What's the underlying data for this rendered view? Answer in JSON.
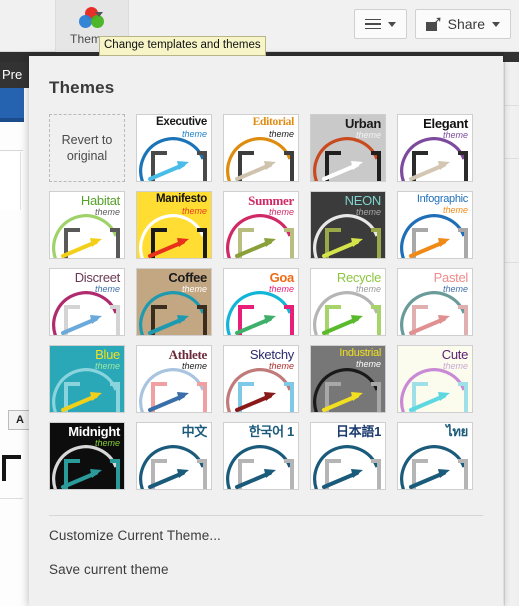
{
  "toolbar": {
    "themes_button_label": "Themes",
    "themes_icon": "color-circles-icon",
    "themes_dropdown_icon": "chevron-down-icon",
    "tooltip_text": "Change templates and themes",
    "menu_icon": "hamburger-icon",
    "menu_dropdown_icon": "chevron-down-icon",
    "share_label": "Share",
    "share_icon": "share-arrow-icon",
    "share_dropdown_icon": "chevron-down-icon"
  },
  "background": {
    "presentation_tab_label": "Pre",
    "align_button_label": "A"
  },
  "panel": {
    "title": "Themes",
    "revert_label": "Revert to original",
    "menu": [
      {
        "label": "Customize Current Theme..."
      },
      {
        "label": "Save current theme"
      }
    ],
    "themes": [
      {
        "name": "Executive",
        "sub": "theme",
        "bg": "#ffffff",
        "title_color": "#1a1a1a",
        "sub_color": "#1d7fc4",
        "arc_color": "#1b74b8",
        "arrow_color": "#49bde8",
        "bracket_color": "#4a4a4a",
        "title_style": "bold"
      },
      {
        "name": "Editorial",
        "sub": "theme",
        "bg": "#ffffff",
        "title_color": "#e08b12",
        "sub_color": "#1a1a1a",
        "arc_color": "#de8c10",
        "arrow_color": "#cfc3ae",
        "bracket_color": "#3d3d3d",
        "title_style": "serif"
      },
      {
        "name": "Urban",
        "sub": "theme",
        "bg": "#c9c9c9",
        "title_color": "#1a1a1a",
        "sub_color": "#f2f2f2",
        "arc_color": "#c94a1e",
        "arrow_color": "#ffffff",
        "bracket_color": "#1f1f1f",
        "title_style": "bold"
      },
      {
        "name": "Elegant",
        "sub": "theme",
        "bg": "#ffffff",
        "title_color": "#111111",
        "sub_color": "#7d4a9e",
        "arc_color": "#7d4a9e",
        "arrow_color": "#d3c6b2",
        "bracket_color": "#2b2b2b",
        "title_style": "bold"
      },
      {
        "name": "Habitat",
        "sub": "theme",
        "bg": "#ffffff",
        "title_color": "#57a22b",
        "sub_color": "#5a5a5a",
        "arc_color": "#9fd36a",
        "arrow_color": "#f2d01a",
        "bracket_color": "#595959",
        "title_style": "normal"
      },
      {
        "name": "Manifesto",
        "sub": "theme",
        "bg": "#ffdd33",
        "title_color": "#111111",
        "sub_color": "#e23d1e",
        "arc_color": "#ffffff",
        "arrow_color": "#e8301a",
        "bracket_color": "#1a1a1a",
        "title_style": "bold"
      },
      {
        "name": "Summer",
        "sub": "theme",
        "bg": "#ffffff",
        "title_color": "#cf2a66",
        "sub_color": "#cf2a66",
        "arc_color": "#cf2a66",
        "arrow_color": "#8aa03a",
        "bracket_color": "#b9bd7e",
        "title_style": "serif"
      },
      {
        "name": "NEON",
        "sub": "theme",
        "bg": "#3b3b3b",
        "title_color": "#7fd4cd",
        "sub_color": "#a8a8a8",
        "arc_color": "#e8e8e8",
        "arrow_color": "#d4e44a",
        "bracket_color": "#9aa84a",
        "title_style": "normal"
      },
      {
        "name": "Infographic",
        "sub": "theme",
        "bg": "#ffffff",
        "title_color": "#1e6fb8",
        "sub_color": "#f08a17",
        "arc_color": "#1e6fb8",
        "arrow_color": "#f08a17",
        "bracket_color": "#a8a8a8",
        "title_style": "normal"
      },
      {
        "name": "Discreet",
        "sub": "theme",
        "bg": "#ffffff",
        "title_color": "#6b3a52",
        "sub_color": "#3b6fa8",
        "arc_color": "#b02a6e",
        "arrow_color": "#6aa9dc",
        "bracket_color": "#d4d4d4",
        "title_style": "normal"
      },
      {
        "name": "Coffee",
        "sub": "theme",
        "bg": "#c3a782",
        "title_color": "#1a1a1a",
        "sub_color": "#ffffff",
        "arc_color": "#1e9ab0",
        "arrow_color": "#1e9ab0",
        "bracket_color": "#3a2c1e",
        "title_style": "bold"
      },
      {
        "name": "Goa",
        "sub": "theme",
        "bg": "#ffffff",
        "title_color": "#f06a14",
        "sub_color": "#e81e78",
        "arc_color": "#12b5d8",
        "arrow_color": "#3fb06a",
        "bracket_color": "#e81e78",
        "title_style": "bold"
      },
      {
        "name": "Recycle",
        "sub": "theme",
        "bg": "#ffffff",
        "title_color": "#8cc63f",
        "sub_color": "#9a9a9a",
        "arc_color": "#b5b5b5",
        "arrow_color": "#5aba2e",
        "bracket_color": "#a6d468",
        "title_style": "normal"
      },
      {
        "name": "Pastel",
        "sub": "theme",
        "bg": "#ffffff",
        "title_color": "#f08c8c",
        "sub_color": "#3f6fa8",
        "arc_color": "#6a9a9a",
        "arrow_color": "#e09090",
        "bracket_color": "#e0b0b0",
        "title_style": "normal"
      },
      {
        "name": "Blue",
        "sub": "theme",
        "bg": "#2aa8b8",
        "title_color": "#f2e020",
        "sub_color": "#9fe8a0",
        "arc_color": "#8ad4de",
        "arrow_color": "#f2d01a",
        "bracket_color": "#8ad4de",
        "title_style": "normal"
      },
      {
        "name": "Athlete",
        "sub": "theme",
        "bg": "#ffffff",
        "title_color": "#6b2a3a",
        "sub_color": "#1a1a1a",
        "arc_color": "#a8c4de",
        "arrow_color": "#3a6ea8",
        "bracket_color": "#f0a0a0",
        "title_style": "serif"
      },
      {
        "name": "Sketchy",
        "sub": "theme",
        "bg": "#ffffff",
        "title_color": "#2a2a6e",
        "sub_color": "#b02a2a",
        "arc_color": "#c07a7a",
        "arrow_color": "#8a1a1a",
        "bracket_color": "#7ec8e8",
        "title_style": "normal"
      },
      {
        "name": "Industrial",
        "sub": "theme",
        "bg": "#777777",
        "title_color": "#f2e020",
        "sub_color": "#ffffff",
        "arc_color": "#1a1a1a",
        "arrow_color": "#f2e020",
        "bracket_color": "#a8a8a8",
        "title_style": "normal"
      },
      {
        "name": "Cute",
        "sub": "theme",
        "bg": "#fbfbee",
        "title_color": "#5a1e6e",
        "sub_color": "#c8a8d4",
        "arc_color": "#c88ad4",
        "arrow_color": "#5ed8e0",
        "bracket_color": "#9fe0e8",
        "title_style": "normal"
      },
      {
        "name": "Midnight",
        "sub": "theme",
        "bg": "#0d0d0d",
        "title_color": "#ffffff",
        "sub_color": "#8ad43a",
        "arc_color": "#d8d8d8",
        "arrow_color": "#2a9a9a",
        "bracket_color": "#2a9a9a",
        "title_style": "bold"
      },
      {
        "name": "中文",
        "sub": "",
        "bg": "#ffffff",
        "title_color": "#1a5a7a",
        "sub_color": "#1a5a7a",
        "arc_color": "#1a5a7a",
        "arrow_color": "#1a5a7a",
        "bracket_color": "#b5b5b5",
        "title_style": "cjk"
      },
      {
        "name": "한국어 1",
        "sub": "",
        "bg": "#ffffff",
        "title_color": "#1a5a7a",
        "sub_color": "#1a5a7a",
        "arc_color": "#1a5a7a",
        "arrow_color": "#1a5a7a",
        "bracket_color": "#b5b5b5",
        "title_style": "cjk"
      },
      {
        "name": "日本語1",
        "sub": "",
        "bg": "#ffffff",
        "title_color": "#1a3a6e",
        "sub_color": "#1a3a6e",
        "arc_color": "#1a5a7a",
        "arrow_color": "#1a5a7a",
        "bracket_color": "#b5b5b5",
        "title_style": "cjk"
      },
      {
        "name": "ไทย",
        "sub": "",
        "bg": "#ffffff",
        "title_color": "#1a5a7a",
        "sub_color": "#1a5a7a",
        "arc_color": "#1a5a7a",
        "arrow_color": "#1a5a7a",
        "bracket_color": "#b5b5b5",
        "title_style": "cjk"
      }
    ]
  }
}
